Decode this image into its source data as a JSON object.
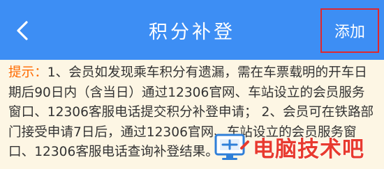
{
  "header": {
    "title": "积分补登",
    "back_icon": "chevron-left-icon",
    "add_label": "添加",
    "bar_color": "#3d8ef4",
    "highlight_color": "#e0272d"
  },
  "notice": {
    "label": "提示：",
    "text": "1、会员如发现乘车积分有遗漏，需在车票载明的开车日期后90日内（含当日）通过12306官网、车站设立的会员服务窗口、12306客服电话提交积分补登申请； 2、会员可在铁路部门接受申请7日后，通过12306官网、车站设立的会员服务窗口、12306客服电话查询补登结果。",
    "label_color": "#ff6a00",
    "background": "#fdf6e4"
  },
  "watermark": {
    "text": "电脑技术吧",
    "icon": "monitor-logo-icon",
    "color": "#e83a2f"
  }
}
